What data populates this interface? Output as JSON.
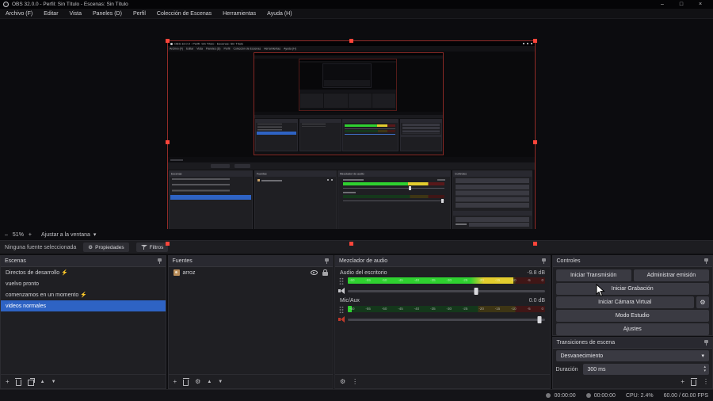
{
  "window": {
    "title": "OBS 32.0.0 - Perfil: Sin Título - Escenas: Sin Título",
    "controls": {
      "minimize": "–",
      "maximize": "□",
      "close": "×"
    }
  },
  "menu": {
    "items": [
      "Archivo (F)",
      "Editar",
      "Vista",
      "Paneles (D)",
      "Perfil",
      "Colección de Escenas",
      "Herramientas",
      "Ayuda (H)"
    ]
  },
  "preview_toolbar": {
    "zoom_out": "–",
    "zoom_level": "51%",
    "zoom_in": "+",
    "fit_label": "Ajustar a la ventana"
  },
  "context_bar": {
    "message": "Ninguna fuente seleccionada",
    "properties_label": "Propiedades",
    "filters_label": "Filtros"
  },
  "scenes": {
    "title": "Escenas",
    "items": [
      {
        "label": "Directos de desarrollo ⚡"
      },
      {
        "label": "vuelvo pronto"
      },
      {
        "label": "comenzamos en un momento ⚡"
      },
      {
        "label": "videos normales"
      }
    ],
    "selected_index": 3
  },
  "sources": {
    "title": "Fuentes",
    "items": [
      {
        "label": "arroz"
      }
    ]
  },
  "mixer": {
    "title": "Mezclador de audio",
    "ticks_text": "-60 -55 -50 -45 -40 -35 -30 -25 -20 -15 -10 -5 0",
    "channels": [
      {
        "name": "Audio del escritorio",
        "db": "-9.8 dB",
        "level_pct": 84,
        "slider_pct": 65
      },
      {
        "name": "Mic/Aux",
        "db": "0.0 dB",
        "level_pct": 2,
        "slider_pct": 97
      }
    ]
  },
  "controls": {
    "title": "Controles",
    "start_streaming": "Iniciar Transmisión",
    "manage_broadcast": "Administrar emisión",
    "start_recording": "Iniciar Grabación",
    "virtual_camera": "Iniciar Cámara Virtual",
    "studio_mode": "Modo Estudio",
    "settings": "Ajustes"
  },
  "transitions": {
    "title": "Transiciones de escena",
    "current": "Desvanecimiento",
    "duration_label": "Duración",
    "duration_value": "300 ms"
  },
  "statusbar": {
    "rec_time": "00:00:00",
    "stream_time": "00:00:00",
    "cpu": "CPU: 2.4%",
    "fps": "60.00 / 60.00 FPS"
  },
  "glyphs": {
    "kebab": "⋮",
    "plus": "+",
    "caret_down": "▾",
    "spin_up": "▴",
    "spin_down": "▾",
    "arrow_up": "▲",
    "arrow_down": "▼",
    "gear": "⚙"
  },
  "colors": {
    "accent_blue": "#2e63c4",
    "meter_green": "#2fd130",
    "meter_yellow": "#e3cd2e",
    "meter_red": "#b03030",
    "selection_red": "#ff453a"
  }
}
